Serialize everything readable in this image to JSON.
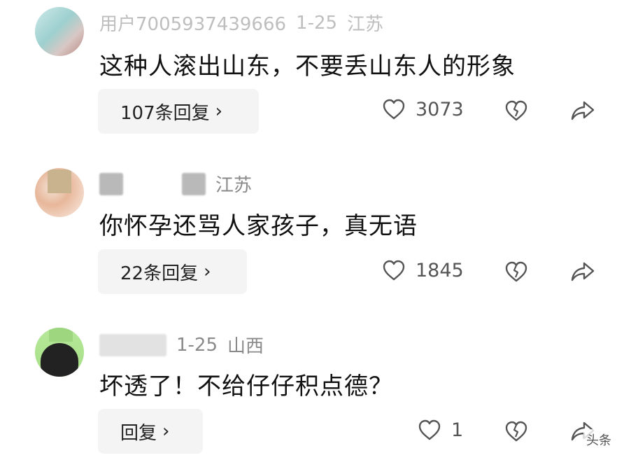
{
  "comments": [
    {
      "user": "用户7005937439666",
      "date": "1-25",
      "location": "江苏",
      "text": "这种人滚出山东，不要丢山东人的形象",
      "replies_label": "107条回复",
      "likes": "3073"
    },
    {
      "user": "",
      "date": "",
      "location": "江苏",
      "text": "你怀孕还骂人家孩子，真无语",
      "replies_label": "22条回复",
      "likes": "1845"
    },
    {
      "user": "",
      "date": "1-25",
      "location": "山西",
      "text": "坏透了！不给仔仔积点德？",
      "replies_label": "回复",
      "likes": "1"
    }
  ],
  "icons": {
    "like": "heart-outline-icon",
    "dislike": "broken-heart-icon",
    "share": "share-arrow-icon",
    "chevron": "chevron-right-icon"
  },
  "colors": {
    "meta_gray": "#8a8a8a",
    "reply_bg": "#f4f4f4",
    "icon_gray": "#555555"
  },
  "chevron_glyph": "›",
  "watermark": "头条"
}
